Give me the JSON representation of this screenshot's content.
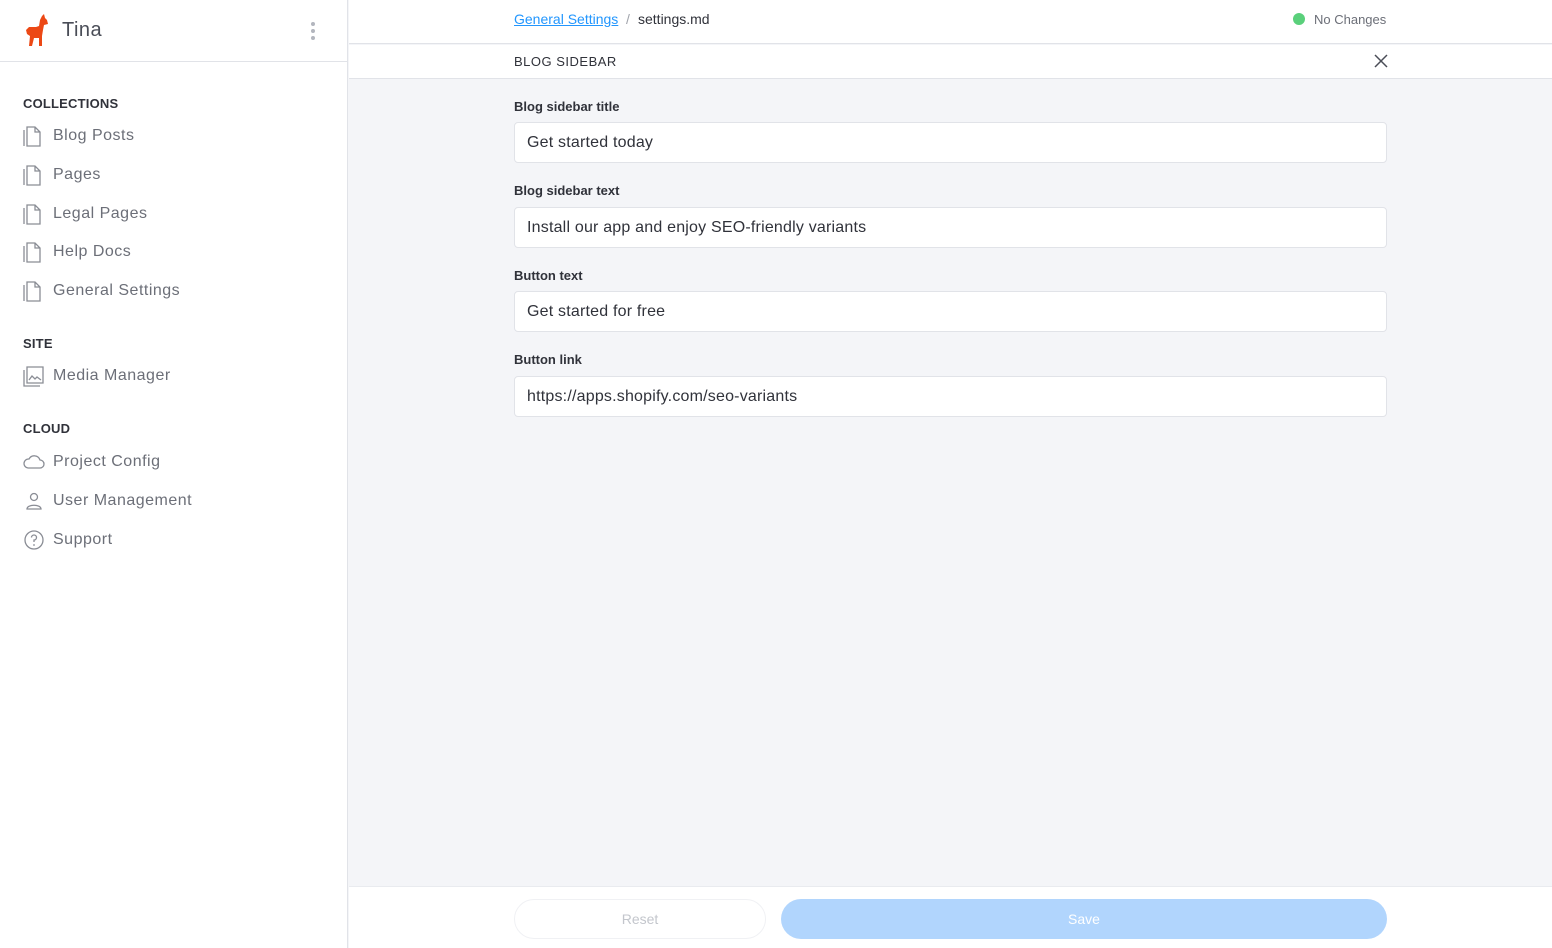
{
  "app": {
    "name": "Tina"
  },
  "sidebar": {
    "sections": [
      {
        "title": "COLLECTIONS",
        "items": [
          {
            "label": "Blog Posts",
            "icon": "document-icon"
          },
          {
            "label": "Pages",
            "icon": "document-icon"
          },
          {
            "label": "Legal Pages",
            "icon": "document-icon"
          },
          {
            "label": "Help Docs",
            "icon": "document-icon"
          },
          {
            "label": "General Settings",
            "icon": "document-icon"
          }
        ]
      },
      {
        "title": "SITE",
        "items": [
          {
            "label": "Media Manager",
            "icon": "image-icon"
          }
        ]
      },
      {
        "title": "CLOUD",
        "items": [
          {
            "label": "Project Config",
            "icon": "cloud-icon"
          },
          {
            "label": "User Management",
            "icon": "user-icon"
          },
          {
            "label": "Support",
            "icon": "help-icon"
          }
        ]
      }
    ]
  },
  "breadcrumb": {
    "collection": "General Settings",
    "separator": "/",
    "file": "settings.md"
  },
  "status": {
    "text": "No Changes",
    "color": "#5ad07b"
  },
  "panel": {
    "title": "BLOG SIDEBAR"
  },
  "form": {
    "fields": [
      {
        "label": "Blog sidebar title",
        "value": "Get started today"
      },
      {
        "label": "Blog sidebar text",
        "value": "Install our app and enjoy SEO-friendly variants"
      },
      {
        "label": "Button text",
        "value": "Get started for free"
      },
      {
        "label": "Button link",
        "value": "https://apps.shopify.com/seo-variants"
      }
    ]
  },
  "actions": {
    "reset_label": "Reset",
    "save_label": "Save"
  },
  "colors": {
    "accent": "#2296fe",
    "brand": "#ec4815",
    "save_disabled": "#b1d5fd"
  }
}
